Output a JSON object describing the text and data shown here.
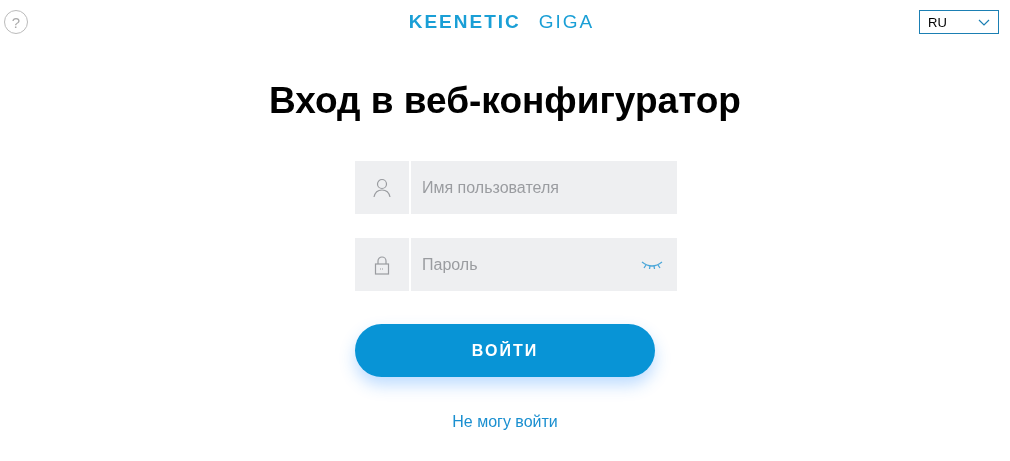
{
  "header": {
    "help": "?",
    "logo": {
      "brand": "KEENETIC",
      "model": "GIGA"
    },
    "language": "RU"
  },
  "title": "Вход в веб-конфигуратор",
  "fields": [
    {
      "kind": "user",
      "placeholder": "Имя пользователя"
    },
    {
      "kind": "password",
      "placeholder": "Пароль",
      "revealed": false
    }
  ],
  "submit": "ВОЙТИ",
  "help_link": "Не могу войти"
}
